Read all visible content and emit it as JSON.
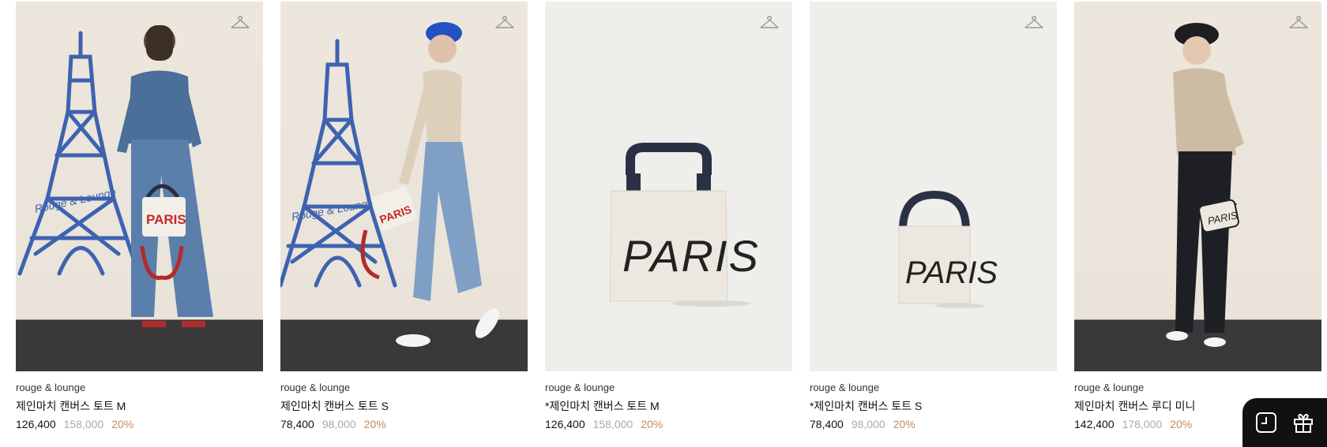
{
  "products": [
    {
      "brand": "rouge & lounge",
      "name": "제인마치 캔버스 토트 M",
      "sale_price": "126,400",
      "original_price": "158,000",
      "discount": "20%",
      "image_type": "model-eiffel-denim",
      "image_print": [
        "PARIS",
        "Rouge & Lounge"
      ]
    },
    {
      "brand": "rouge & lounge",
      "name": "제인마치 캔버스 토트 S",
      "sale_price": "78,400",
      "original_price": "98,000",
      "discount": "20%",
      "image_type": "model-eiffel-beret",
      "image_print": [
        "PARIS",
        "Rouge & Lounge"
      ]
    },
    {
      "brand": "rouge & lounge",
      "name": "*제인마치 캔버스 토트 M",
      "sale_price": "126,400",
      "original_price": "158,000",
      "discount": "20%",
      "image_type": "product-tote-m",
      "image_print": [
        "PARIS"
      ]
    },
    {
      "brand": "rouge & lounge",
      "name": "*제인마치 캔버스 토트 S",
      "sale_price": "78,400",
      "original_price": "98,000",
      "discount": "20%",
      "image_type": "product-tote-s",
      "image_print": [
        "PARIS"
      ]
    },
    {
      "brand": "rouge & lounge",
      "name": "제인마치 캔버스 루디 미니",
      "sale_price": "142,400",
      "original_price": "178,000",
      "discount": "20%",
      "image_type": "model-black-trousers",
      "image_print": [
        "PARIS"
      ]
    }
  ],
  "wishlist_icon": "hanger-icon",
  "floating_bar": {
    "recent_icon": "clock-icon",
    "gift_icon": "gift-icon"
  },
  "colors": {
    "discount": "#c8885a",
    "original_price": "#aaaaaa",
    "eiffel_blue": "#3d63b0",
    "floating_bar": "#111111"
  }
}
